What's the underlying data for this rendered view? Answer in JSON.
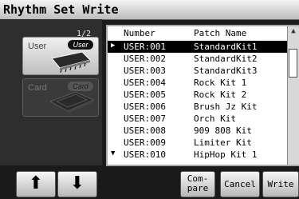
{
  "title": "Rhythm Set Write",
  "media_panel": {
    "page_indicator": "1/2",
    "user": {
      "label": "User",
      "tag": "User"
    },
    "card": {
      "label": "Card",
      "tag": "Card"
    }
  },
  "list": {
    "columns": [
      "Number",
      "Patch Name"
    ],
    "selected_index": 0,
    "rows": [
      {
        "number": "USER:001",
        "name": "StandardKit1"
      },
      {
        "number": "USER:002",
        "name": "StandardKit2"
      },
      {
        "number": "USER:003",
        "name": "StandardKit3"
      },
      {
        "number": "USER:004",
        "name": "Rock Kit 1"
      },
      {
        "number": "USER:005",
        "name": "Rock Kit 2"
      },
      {
        "number": "USER:006",
        "name": "Brush Jz Kit"
      },
      {
        "number": "USER:007",
        "name": "Orch Kit"
      },
      {
        "number": "USER:008",
        "name": "909 808 Kit"
      },
      {
        "number": "USER:009",
        "name": "Limiter Kit"
      },
      {
        "number": "USER:010",
        "name": "HipHop Kit 1"
      }
    ]
  },
  "buttons": {
    "up": "⬆",
    "down": "⬇",
    "compare_line1": "Com-",
    "compare_line2": "pare",
    "cancel": "Cancel",
    "write": "Write"
  },
  "icons": {
    "user_media": "memory-chip-icon",
    "card_media": "memory-card-icon",
    "scroll_up": "triangle-up-icon",
    "selected_marker": "triangle-right-icon",
    "more_below": "triangle-down-icon"
  }
}
